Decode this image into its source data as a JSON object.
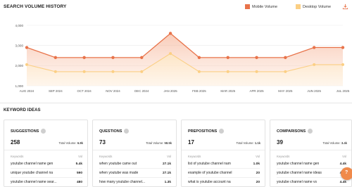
{
  "search_volume": {
    "title": "SEARCH VOLUME HISTORY",
    "legend": [
      {
        "label": "Mobile Volume",
        "color": "#e8734a"
      },
      {
        "label": "Desktop Volume",
        "color": "#fbcf84"
      }
    ]
  },
  "chart_data": {
    "type": "area",
    "title": "SEARCH VOLUME HISTORY",
    "categories": [
      "AUG 2024",
      "SEP 2024",
      "OCT 2024",
      "NOV 2024",
      "DEC 2024",
      "JAN 2025",
      "FEB 2025",
      "MAR 2025",
      "APR 2025",
      "MAY 2025",
      "JUN 2025",
      "JUL 2025"
    ],
    "y_ticks": [
      "4,000",
      "3,000",
      "2,000",
      "1,000"
    ],
    "ylim": [
      1000,
      4000
    ],
    "grid": true,
    "legend_position": "top-right",
    "series": [
      {
        "name": "Mobile Volume",
        "color": "#e8734a",
        "values": [
          2900,
          2400,
          2400,
          2400,
          2400,
          3600,
          2400,
          2400,
          2400,
          2400,
          2900,
          2900
        ]
      },
      {
        "name": "Desktop Volume",
        "color": "#fbcf84",
        "values": [
          2050,
          1700,
          1700,
          1700,
          1700,
          2600,
          1700,
          1700,
          1700,
          1700,
          2050,
          2050
        ]
      }
    ]
  },
  "keyword_ideas": {
    "title": "KEYWORD IDEAS",
    "cards": [
      {
        "name": "SUGGESTIONS",
        "count": "258",
        "total_label": "Total Volume:",
        "total_value": "6.8k",
        "col_keywords": "Keywords",
        "col_vol": "Vol",
        "rows": [
          {
            "keyword": "youtube channel name gen",
            "vol": "5.4k"
          },
          {
            "keyword": "unique youtube channel na",
            "vol": "590"
          },
          {
            "keyword": "youtube channel name sear...",
            "vol": "480"
          }
        ]
      },
      {
        "name": "QUESTIONS",
        "count": "73",
        "total_label": "Total Volume:",
        "total_value": "58.5k",
        "col_keywords": "Keywords",
        "col_vol": "Vol",
        "rows": [
          {
            "keyword": "when youtube came out",
            "vol": "27.1k"
          },
          {
            "keyword": "when youtube was made",
            "vol": "27.1k"
          },
          {
            "keyword": "how many youtube channel...",
            "vol": "1.3k"
          }
        ]
      },
      {
        "name": "PREPOSITIONS",
        "count": "17",
        "total_label": "Total Volume:",
        "total_value": "1.1k",
        "col_keywords": "Keywords",
        "col_vol": "Vol",
        "rows": [
          {
            "keyword": "list of youtube channel nam",
            "vol": "1.0k"
          },
          {
            "keyword": "example of youtube channel",
            "vol": "20"
          },
          {
            "keyword": "what is youtube account na",
            "vol": "20"
          }
        ]
      },
      {
        "name": "COMPARISONS",
        "count": "39",
        "total_label": "Total Volume:",
        "total_value": "3.4k",
        "col_keywords": "Keywords",
        "col_vol": "Vol",
        "rows": [
          {
            "keyword": "youtube channel name gen",
            "vol": "4.4k"
          },
          {
            "keyword": "youtube channel name ideas",
            "vol": "4.4k"
          },
          {
            "keyword": "youtube channel name vs",
            "vol": "4.4k"
          }
        ]
      }
    ]
  },
  "icons": {
    "download": "download-icon",
    "info": "info-icon",
    "chat": "chat-bubble-icon"
  }
}
